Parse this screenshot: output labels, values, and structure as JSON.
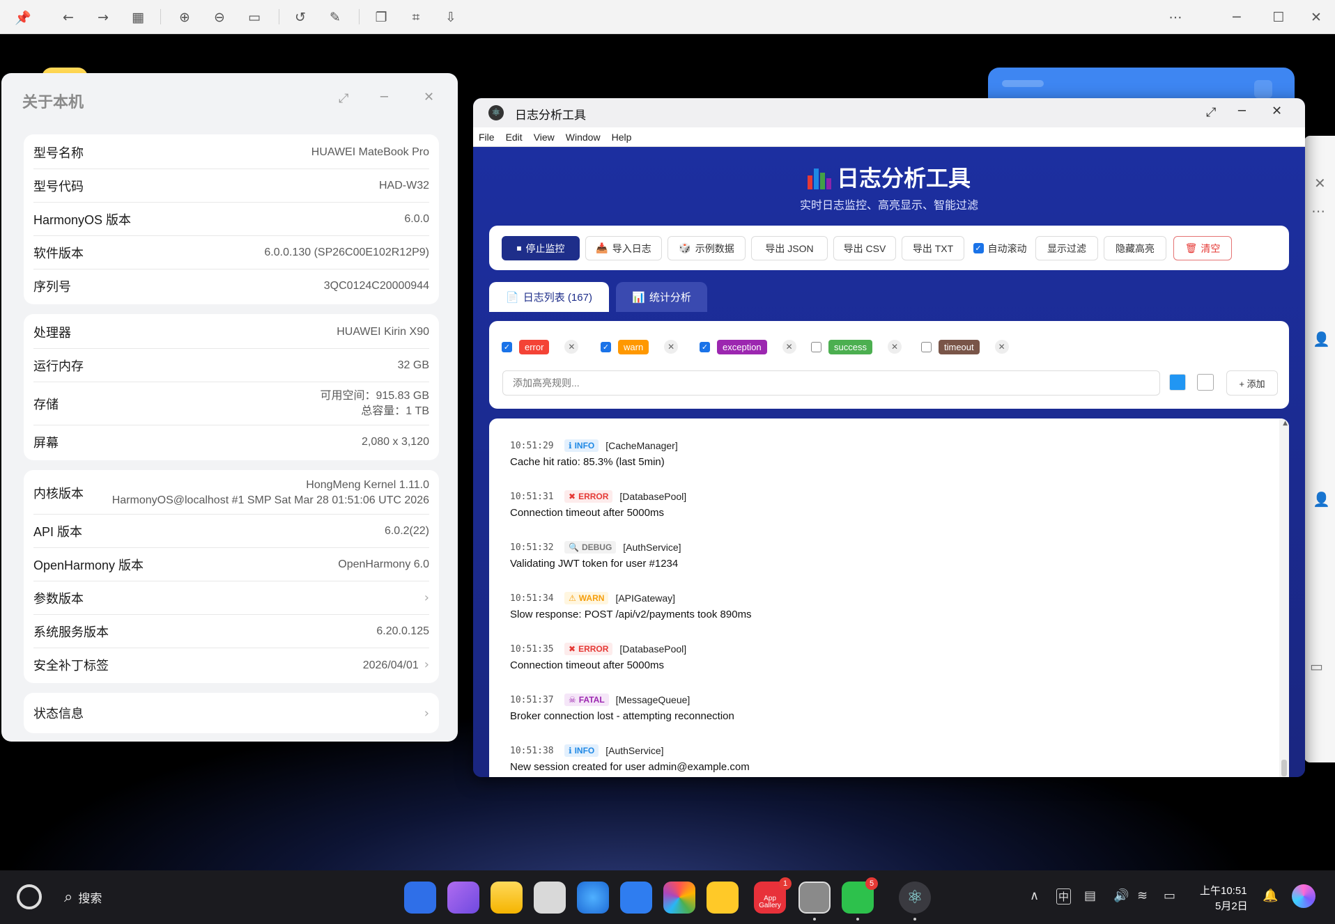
{
  "toolbar": {
    "icons": [
      "pin-icon",
      "back-icon",
      "forward-icon",
      "grid-icon",
      "zoom-in-icon",
      "zoom-out-icon",
      "actual-size-icon",
      "rotate-icon",
      "edit-icon",
      "copy-icon",
      "crop-icon",
      "export-icon",
      "more-icon",
      "minimize-icon",
      "maximize-icon",
      "close-icon"
    ]
  },
  "about": {
    "title": "关于本机",
    "device": [
      {
        "label": "型号名称",
        "value": "HUAWEI MateBook Pro"
      },
      {
        "label": "型号代码",
        "value": "HAD-W32"
      },
      {
        "label": "HarmonyOS 版本",
        "value": "6.0.0"
      },
      {
        "label": "软件版本",
        "value": "6.0.0.130 (SP26C00E102R12P9)"
      },
      {
        "label": "序列号",
        "value": "3QC0124C20000944"
      }
    ],
    "hardware": {
      "cpu_label": "处理器",
      "cpu_value": "HUAWEI Kirin X90",
      "ram_label": "运行内存",
      "ram_value": "32 GB",
      "storage_label": "存储",
      "storage_free": "可用空间：915.83 GB",
      "storage_total": "总容量：1 TB",
      "screen_label": "屏幕",
      "screen_value": "2,080 x 3,120"
    },
    "software": {
      "kernel_label": "内核版本",
      "kernel_line1": "HongMeng Kernel 1.11.0",
      "kernel_line2": "HarmonyOS@localhost #1 SMP Sat Mar 28 01:51:06 UTC 2026",
      "api_label": "API 版本",
      "api_value": "6.0.2(22)",
      "oh_label": "OpenHarmony 版本",
      "oh_value": "OpenHarmony 6.0",
      "param_label": "参数版本",
      "svc_label": "系统服务版本",
      "svc_value": "6.20.0.125",
      "patch_label": "安全补丁标签",
      "patch_value": "2026/04/01"
    },
    "status_label": "状态信息"
  },
  "logtool": {
    "window_title": "日志分析工具",
    "menu": [
      "File",
      "Edit",
      "View",
      "Window",
      "Help"
    ],
    "hero_title": "日志分析工具",
    "hero_subtitle": "实时日志监控、高亮显示、智能过滤",
    "buttons": {
      "stop": "停止监控",
      "import": "导入日志",
      "sample": "示例数据",
      "json": "导出 JSON",
      "csv": "导出 CSV",
      "txt": "导出 TXT",
      "autoscroll": "自动滚动",
      "show_filter": "显示过滤",
      "hide_hl": "隐藏高亮",
      "clear": "清空"
    },
    "tabs": {
      "logs": "日志列表 (167)",
      "stats": "统计分析"
    },
    "highlights": [
      {
        "text": "error",
        "checked": true,
        "color": "#f44336"
      },
      {
        "text": "warn",
        "checked": true,
        "color": "#ff9800"
      },
      {
        "text": "exception",
        "checked": true,
        "color": "#9c27b0"
      },
      {
        "text": "success",
        "checked": false,
        "color": "#4caf50"
      },
      {
        "text": "timeout",
        "checked": false,
        "color": "#795548"
      }
    ],
    "input_placeholder": "添加高亮规则...",
    "add_label": "+ 添加",
    "logs": [
      {
        "time": "10:51:29",
        "level": "INFO",
        "source": "[CacheManager]",
        "message": "Cache hit ratio: 85.3% (last 5min)"
      },
      {
        "time": "10:51:31",
        "level": "ERROR",
        "source": "[DatabasePool]",
        "message": "Connection timeout after 5000ms"
      },
      {
        "time": "10:51:32",
        "level": "DEBUG",
        "source": "[AuthService]",
        "message": "Validating JWT token for user #1234"
      },
      {
        "time": "10:51:34",
        "level": "WARN",
        "source": "[APIGateway]",
        "message": "Slow response: POST /api/v2/payments took 890ms"
      },
      {
        "time": "10:51:35",
        "level": "ERROR",
        "source": "[DatabasePool]",
        "message": "Connection timeout after 5000ms"
      },
      {
        "time": "10:51:37",
        "level": "FATAL",
        "source": "[MessageQueue]",
        "message": "Broker connection lost - attempting reconnection"
      },
      {
        "time": "10:51:38",
        "level": "INFO",
        "source": "[AuthService]",
        "message": "New session created for user admin@example.com"
      }
    ],
    "level_styles": {
      "INFO": {
        "glyph": "ℹ",
        "fg": "#1e88e5",
        "bg": "#e3f0fd"
      },
      "ERROR": {
        "glyph": "✖",
        "fg": "#e53935",
        "bg": "#fdecec"
      },
      "DEBUG": {
        "glyph": "🔍",
        "fg": "#777777",
        "bg": "#f2f2f2"
      },
      "WARN": {
        "glyph": "⚠",
        "fg": "#f59e0b",
        "bg": "#fff6e0"
      },
      "FATAL": {
        "glyph": "☠",
        "fg": "#9c27b0",
        "bg": "#f5e6f8"
      }
    }
  },
  "taskbar": {
    "search_label": "搜索",
    "appgallery_label": "App Gallery",
    "appgallery_badge": "1",
    "wechat_badge": "5",
    "ime_label": "中",
    "time": "上午10:51",
    "date": "5月2日"
  }
}
